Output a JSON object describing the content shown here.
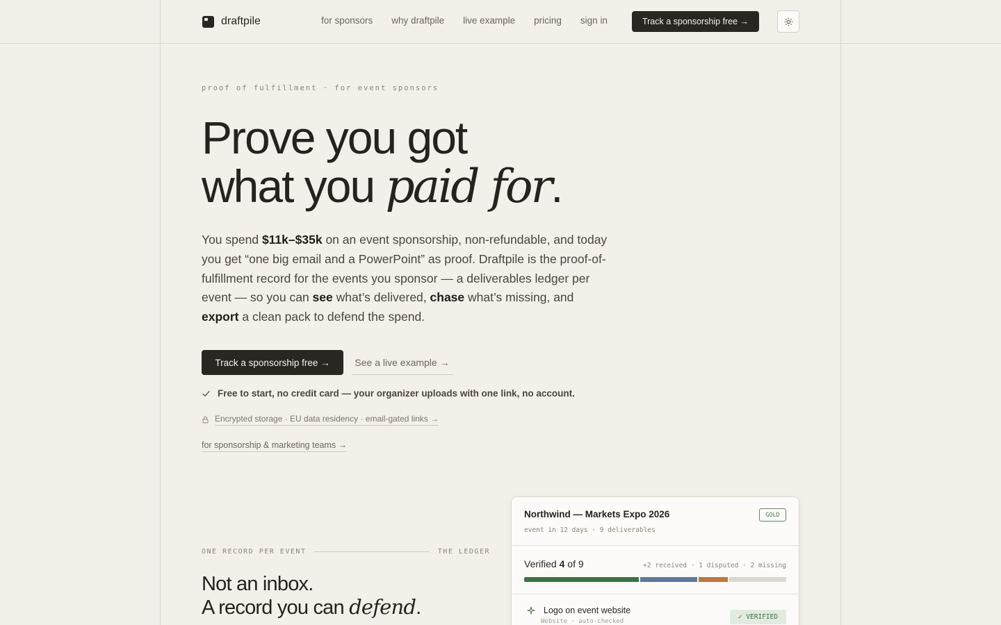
{
  "brand": {
    "name": "draftpile"
  },
  "nav": {
    "items": [
      {
        "label": "for sponsors"
      },
      {
        "label": "why draftpile"
      },
      {
        "label": "live example"
      },
      {
        "label": "pricing"
      },
      {
        "label": "sign in"
      }
    ],
    "cta": "Track a sponsorship free →"
  },
  "hero": {
    "eyebrow": "proof of fulfillment · for event sponsors",
    "headline_line1": "Prove you got",
    "headline_line2_pre": "what you ",
    "headline_line2_em": "paid for",
    "headline_line2_post": ".",
    "lede": {
      "p1": "You spend ",
      "b1": "$11k–$35k",
      "p2": " on an event sponsorship, non-refundable, and today you get “one big email and a PowerPoint” as proof. Draftpile is the proof-of-fulfillment record for the events you sponsor — a deliverables ledger per event — so you can ",
      "b2": "see",
      "p3": " what’s delivered, ",
      "b3": "chase",
      "p4": " what’s missing, and ",
      "b4": "export",
      "p5": " a clean pack to defend the spend."
    },
    "primary_cta": "Track a sponsorship free →",
    "secondary_cta": "See a live example →",
    "free_note": "Free to start, no credit card — your organizer uploads with one link, no account.",
    "security_note": "Encrypted storage · EU data residency · email-gated links →",
    "teams_link": "for sponsorship & marketing teams →"
  },
  "section": {
    "eyebrow_left": "ONE RECORD PER EVENT",
    "eyebrow_right": "THE LEDGER",
    "title_line1": "Not an inbox.",
    "title_line2_pre": "A record you can ",
    "title_line2_em": "defend",
    "title_line2_post": "."
  },
  "ledger_card": {
    "title": "Northwind — Markets Expo 2026",
    "tier": "GOLD",
    "subtitle": "event in 12 days · 9 deliverables",
    "verified_pre": "Verified ",
    "verified_count": "4",
    "verified_mid": " of ",
    "verified_total": "9",
    "counts": "+2 received · 1 disputed · 2 missing",
    "progress": {
      "total": 9,
      "segments": [
        {
          "status": "verified",
          "count": 4,
          "color": "#3f7149"
        },
        {
          "status": "received",
          "count": 2,
          "color": "#5f7896"
        },
        {
          "status": "disputed",
          "count": 1,
          "color": "#b87a3d"
        },
        {
          "status": "missing",
          "count": 2,
          "color": "#dcd8d1"
        }
      ]
    },
    "item": {
      "label": "Logo on event website",
      "sub": "Website · auto-checked",
      "status": "✓ VERIFIED",
      "icon": "sparkle-icon"
    }
  },
  "colors": {
    "background": "#f3f0ea",
    "ink": "#2a2621",
    "accent_green": "#3f7149"
  }
}
